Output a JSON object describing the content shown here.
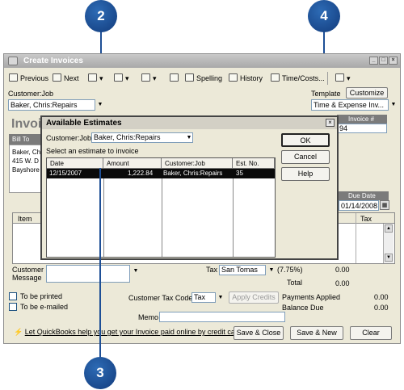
{
  "callouts": {
    "c2": "2",
    "c4": "4",
    "c3": "3"
  },
  "window": {
    "title": "Create Invoices"
  },
  "toolbar": {
    "previous": "Previous",
    "next": "Next",
    "spelling": "Spelling",
    "history": "History",
    "time_costs": "Time/Costs..."
  },
  "form": {
    "customer_job_label": "Customer:Job",
    "customer_job_value": "Baker, Chris:Repairs",
    "template_label": "Template",
    "customize_label": "Customize",
    "template_value": "Time & Expense Inv...",
    "invoice_heading": "Invoi",
    "bill_to_label": "Bill To",
    "bill_to_lines": [
      "Baker, Ch",
      "415 W. D",
      "Bayshore"
    ],
    "invoice_number_label": "Invoice #",
    "invoice_number": "94",
    "due_date_label": "Due Date",
    "due_date": "01/14/2008",
    "col_item": "Item",
    "col_tax": "Tax",
    "customer_message_label": "Customer Message",
    "tax_label": "Tax",
    "tax_item": "San Tomas",
    "tax_rate": "(7.75%)",
    "tax_amount": "0.00",
    "total_label": "Total",
    "total_amount": "0.00",
    "to_be_printed": "To be printed",
    "to_be_emailed": "To be e-mailed",
    "customer_tax_code_label": "Customer Tax Code",
    "customer_tax_code": "Tax",
    "apply_credits": "Apply Credits",
    "payments_applied_label": "Payments Applied",
    "payments_applied": "0.00",
    "balance_due_label": "Balance Due",
    "balance_due": "0.00",
    "memo_label": "Memo",
    "online_link": "Let QuickBooks help you get your Invoice paid online by credit card.",
    "save_close": "Save & Close",
    "save_new": "Save & New",
    "clear": "Clear"
  },
  "dialog": {
    "title": "Available Estimates",
    "customer_job_label": "Customer:Job",
    "customer_job_value": "Baker, Chris:Repairs",
    "instruction": "Select an estimate to invoice",
    "columns": [
      "Date",
      "Amount",
      "Customer:Job",
      "Est. No."
    ],
    "rows": [
      {
        "date": "12/15/2007",
        "amount": "1,222.84",
        "customer_job": "Baker, Chris:Repairs",
        "est_no": "35"
      }
    ],
    "ok": "OK",
    "cancel": "Cancel",
    "help": "Help"
  }
}
